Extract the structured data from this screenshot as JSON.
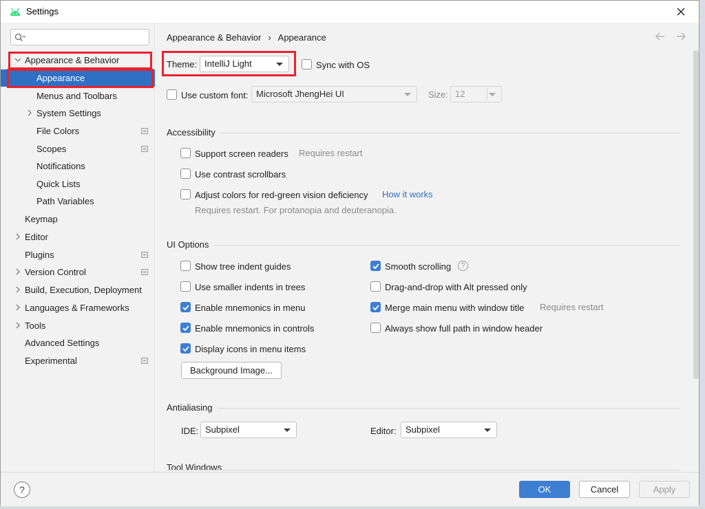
{
  "window": {
    "title": "Settings"
  },
  "search": {
    "placeholder": "",
    "value": ""
  },
  "sidebar": {
    "items": [
      {
        "label": "Appearance & Behavior",
        "level": 0,
        "expanded": true,
        "bold": true
      },
      {
        "label": "Appearance",
        "level": 1,
        "selected": true
      },
      {
        "label": "Menus and Toolbars",
        "level": 1
      },
      {
        "label": "System Settings",
        "level": 1,
        "expandable": true
      },
      {
        "label": "File Colors",
        "level": 1,
        "project": true
      },
      {
        "label": "Scopes",
        "level": 1,
        "project": true
      },
      {
        "label": "Notifications",
        "level": 1
      },
      {
        "label": "Quick Lists",
        "level": 1
      },
      {
        "label": "Path Variables",
        "level": 1
      },
      {
        "label": "Keymap",
        "level": 0
      },
      {
        "label": "Editor",
        "level": 0,
        "expandable": true
      },
      {
        "label": "Plugins",
        "level": 0,
        "project": true
      },
      {
        "label": "Version Control",
        "level": 0,
        "expandable": true,
        "project": true
      },
      {
        "label": "Build, Execution, Deployment",
        "level": 0,
        "expandable": true
      },
      {
        "label": "Languages & Frameworks",
        "level": 0,
        "expandable": true
      },
      {
        "label": "Tools",
        "level": 0,
        "expandable": true
      },
      {
        "label": "Advanced Settings",
        "level": 0
      },
      {
        "label": "Experimental",
        "level": 0,
        "project": true
      }
    ]
  },
  "breadcrumb": {
    "parent": "Appearance & Behavior",
    "separator": "›",
    "current": "Appearance"
  },
  "theme": {
    "label": "Theme:",
    "value": "IntelliJ Light",
    "sync_label": "Sync with OS",
    "sync_checked": false
  },
  "font": {
    "checkbox_label": "Use custom font:",
    "checked": false,
    "value": "Microsoft JhengHei UI",
    "size_label": "Size:",
    "size_value": "12"
  },
  "accessibility": {
    "title": "Accessibility",
    "screen_readers": "Support screen readers",
    "screen_readers_note": "Requires restart",
    "contrast_scrollbars": "Use contrast scrollbars",
    "adjust_colors": "Adjust colors for red-green vision deficiency",
    "how_it_works": "How it works",
    "adjust_note": "Requires restart. For protanopia and deuteranopia."
  },
  "ui_options": {
    "title": "UI Options",
    "tree_indent": "Show tree indent guides",
    "smaller_indents": "Use smaller indents in trees",
    "mnemonics_menu": "Enable mnemonics in menu",
    "mnemonics_controls": "Enable mnemonics in controls",
    "icons_menu": "Display icons in menu items",
    "smooth_scrolling": "Smooth scrolling",
    "help_glyph": "?",
    "drag_drop": "Drag-and-drop with Alt pressed only",
    "merge_menu": "Merge main menu with window title",
    "merge_note": "Requires restart",
    "full_path": "Always show full path in window header",
    "background_button": "Background Image..."
  },
  "antialiasing": {
    "title": "Antialiasing",
    "ide_label": "IDE:",
    "ide_value": "Subpixel",
    "editor_label": "Editor:",
    "editor_value": "Subpixel"
  },
  "tool_windows": {
    "title": "Tool Windows"
  },
  "footer": {
    "help": "?",
    "ok": "OK",
    "cancel": "Cancel",
    "apply": "Apply"
  },
  "colors": {
    "accent": "#3d7ed1",
    "selection": "#2f70c4",
    "annotation": "#e8222e",
    "link": "#2f6fbd"
  }
}
